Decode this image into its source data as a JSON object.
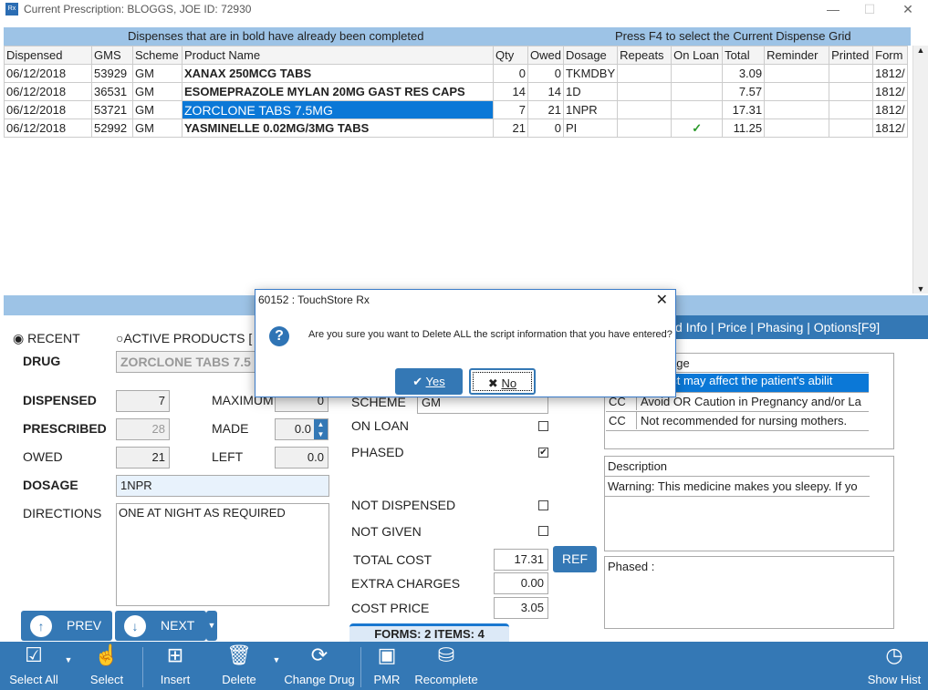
{
  "window": {
    "title": "Current Prescription: BLOGGS, JOE   ID: 72930",
    "app_icon": "Rx"
  },
  "grid": {
    "header_left": "Dispenses that are in bold have already been completed",
    "header_right": "Press F4 to select the Current Dispense Grid",
    "columns": [
      "Dispensed",
      "GMS",
      "Scheme",
      "Product Name",
      "Qty",
      "Owed",
      "Dosage",
      "Repeats",
      "On Loan",
      "Total",
      "Reminder",
      "Printed",
      "Form"
    ],
    "rows": [
      {
        "dispensed": "06/12/2018",
        "gms": "53929",
        "scheme": "GM",
        "product": "XANAX 250MCG TABS",
        "qty": "0",
        "owed": "0",
        "dosage": "TKMDBY",
        "repeats": "",
        "on_loan": "",
        "total": "3.09",
        "reminder": "",
        "printed": "",
        "form": "1812/"
      },
      {
        "dispensed": "06/12/2018",
        "gms": "36531",
        "scheme": "GM",
        "product": "ESOMEPRAZOLE MYLAN 20MG GAST RES CAPS",
        "qty": "14",
        "owed": "14",
        "dosage": "1D",
        "repeats": "",
        "on_loan": "",
        "total": "7.57",
        "reminder": "",
        "printed": "",
        "form": "1812/"
      },
      {
        "dispensed": "06/12/2018",
        "gms": "53721",
        "scheme": "GM",
        "product": "ZORCLONE TABS 7.5MG",
        "qty": "7",
        "owed": "21",
        "dosage": "1NPR",
        "repeats": "",
        "on_loan": "",
        "total": "17.31",
        "reminder": "",
        "printed": "",
        "form": "1812/"
      },
      {
        "dispensed": "06/12/2018",
        "gms": "52992",
        "scheme": "GM",
        "product": "YASMINELLE 0.02MG/3MG TABS",
        "qty": "21",
        "owed": "0",
        "dosage": "PI",
        "repeats": "",
        "on_loan": "✓",
        "total": "11.25",
        "reminder": "",
        "printed": "",
        "form": "1812/"
      }
    ]
  },
  "form": {
    "recent": "RECENT",
    "active_products": "ACTIVE PRODUCTS [",
    "drug_label": "DRUG",
    "drug": "ZORCLONE TABS 7.5",
    "dispensed_label": "DISPENSED",
    "dispensed": "7",
    "prescribed_label": "PRESCRIBED",
    "prescribed": "28",
    "owed_label": "OWED",
    "owed": "21",
    "maximum_label": "MAXIMUM",
    "maximum": "0",
    "made_label": "MADE",
    "made": "0.0",
    "left_label": "LEFT",
    "left": "0.0",
    "dosage_label": "DOSAGE",
    "dosage": "1NPR",
    "directions_label": "DIRECTIONS",
    "directions": "ONE AT NIGHT AS REQUIRED",
    "scheme_label": "SCHEME",
    "scheme": "GM",
    "on_loan_label": "ON LOAN",
    "phased_label": "PHASED",
    "not_dispensed_label": "NOT DISPENSED",
    "not_given_label": "NOT GIVEN",
    "total_cost_label": "TOTAL COST",
    "total_cost": "17.31",
    "ref": "REF",
    "extra_charges_label": "EXTRA CHARGES",
    "extra_charges": "0.00",
    "cost_price_label": "COST PRICE",
    "cost_price": "3.05",
    "prev": "PREV",
    "next": "NEXT",
    "forms_items": "FORMS: 2  ITEMS: 4"
  },
  "right_panel": {
    "tabs": [
      "d Info",
      "Price",
      "Phasing",
      "Options[F9]"
    ],
    "warnings_header": "age",
    "warnings": [
      {
        "code": "",
        "text": "product may affect the patient's abilit"
      },
      {
        "code": "CC",
        "text": "Avoid OR Caution in Pregnancy and/or La"
      },
      {
        "code": "CC",
        "text": "Not recommended for nursing mothers."
      }
    ],
    "description_header": "Description",
    "description": "Warning: This medicine makes you sleepy. If yo",
    "phased": "Phased :"
  },
  "dialog": {
    "title": "60152 : TouchStore Rx",
    "message": "Are you sure you want to Delete ALL the script information that you have entered?",
    "yes": "Yes",
    "no": "No"
  },
  "toolbar": [
    "Select All",
    "Select",
    "Insert",
    "Delete",
    "Change Drug",
    "PMR",
    "Recomplete",
    "Show Hist"
  ]
}
